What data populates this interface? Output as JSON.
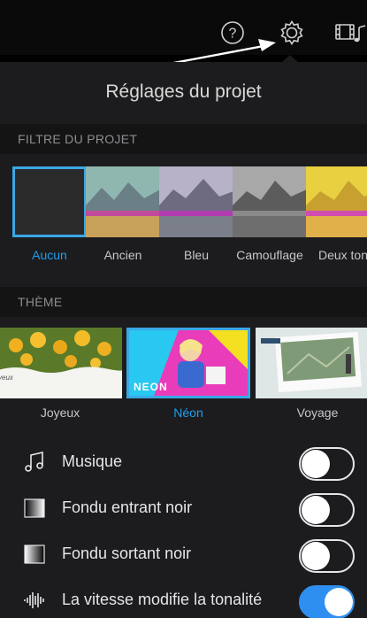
{
  "toolbar": {
    "help_icon": "question-circle-icon",
    "settings_icon": "gear-icon",
    "media_icon": "film-music-icon"
  },
  "panel": {
    "title": "Réglages du projet"
  },
  "filters_section": {
    "header": "FILTRE DU PROJET",
    "selected": "Aucun",
    "items": [
      {
        "label": "Aucun"
      },
      {
        "label": "Ancien"
      },
      {
        "label": "Bleu"
      },
      {
        "label": "Camouflage"
      },
      {
        "label": "Deux ton"
      }
    ]
  },
  "theme_section": {
    "header": "THÈME",
    "selected": "Néon",
    "items": [
      {
        "label": "Joyeux",
        "overlay": "yeux"
      },
      {
        "label": "Néon",
        "overlay": "NEON"
      },
      {
        "label": "Voyage"
      }
    ]
  },
  "settings": [
    {
      "label": "Musique",
      "icon": "music-note-icon",
      "on": false
    },
    {
      "label": "Fondu entrant noir",
      "icon": "fade-in-icon",
      "on": false
    },
    {
      "label": "Fondu sortant noir",
      "icon": "fade-out-icon",
      "on": false
    },
    {
      "label": "La vitesse modifie la tonalité",
      "icon": "waveform-icon",
      "on": true
    }
  ],
  "colors": {
    "accent": "#1ea0f0",
    "toggle_on": "#2f8ff0",
    "panel_bg": "#1c1c1e"
  }
}
